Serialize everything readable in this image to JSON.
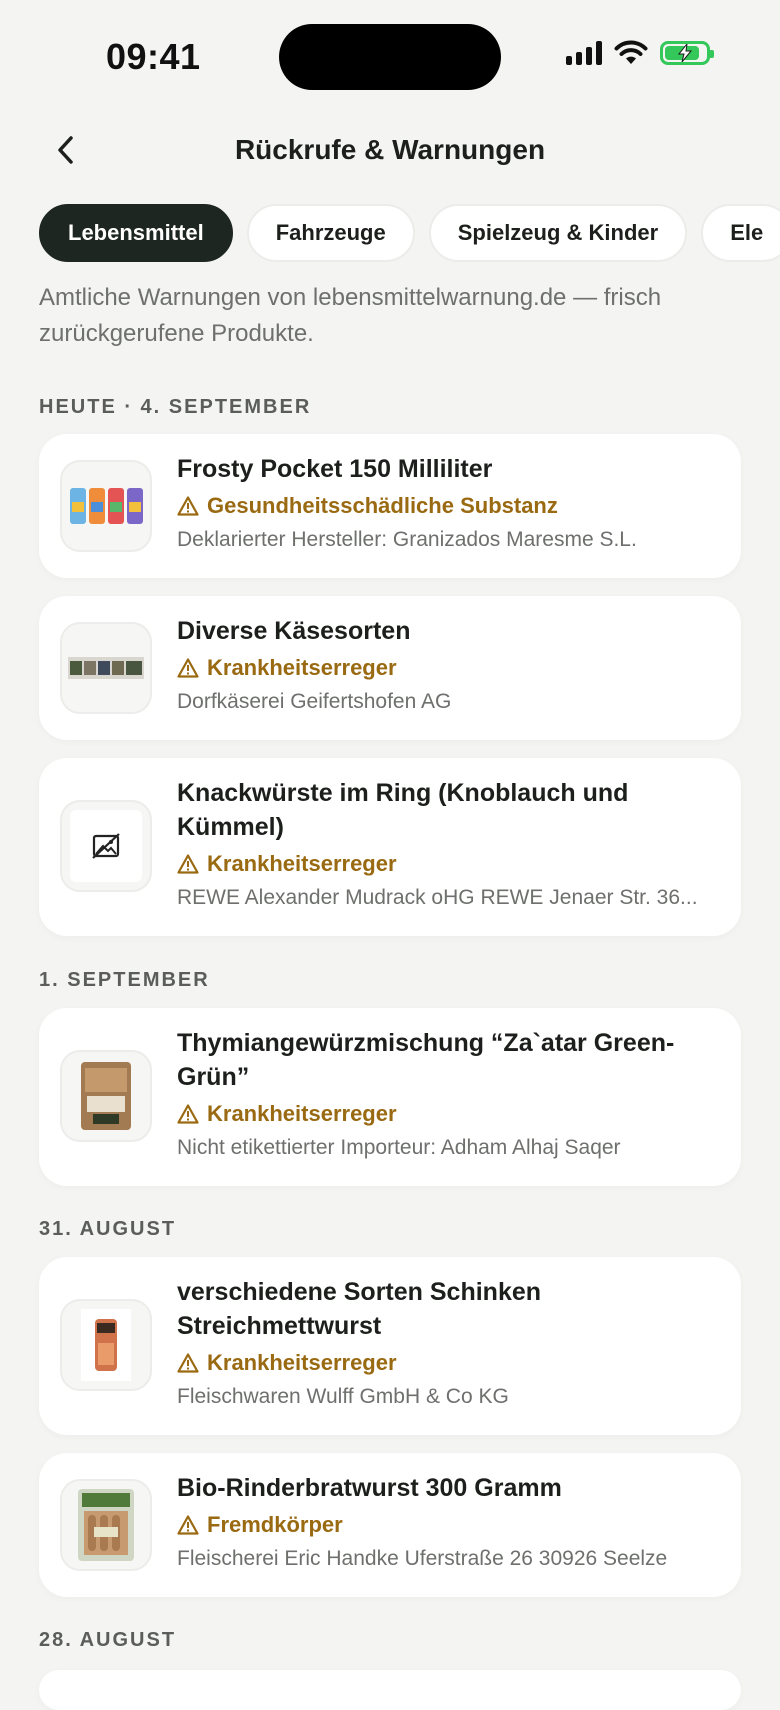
{
  "status_bar": {
    "time": "09:41"
  },
  "header": {
    "title": "Rückrufe & Warnungen"
  },
  "tabs": [
    {
      "label": "Lebensmittel",
      "active": true
    },
    {
      "label": "Fahrzeuge",
      "active": false
    },
    {
      "label": "Spielzeug & Kinder",
      "active": false
    },
    {
      "label": "Ele",
      "active": false
    }
  ],
  "intro": "Amtliche Warnungen von lebensmittelwarnung.de — frisch zurückgerufene Produkte.",
  "sections": [
    {
      "label": "HEUTE · 4. SEPTEMBER",
      "items": [
        {
          "title": "Frosty Pocket 150 Milliliter",
          "warning": "Gesundheitsschädliche Substanz",
          "subtitle": "Deklarierter Hersteller: Granizados Maresme S.L.",
          "thumb": "pouches"
        },
        {
          "title": "Diverse Käsesorten",
          "warning": "Krankheitserreger",
          "subtitle": "Dorfkäserei Geifertshofen AG",
          "thumb": "cheese-strip"
        },
        {
          "title": "Knackwürste im Ring (Knoblauch und Kümmel)",
          "warning": "Krankheitserreger",
          "subtitle": "REWE Alexander Mudrack oHG REWE Jenaer Str. 36...",
          "thumb": "image-missing-icon"
        }
      ]
    },
    {
      "label": "1. SEPTEMBER",
      "items": [
        {
          "title": "Thymiangewürzmischung “Za`atar Green-Grün”",
          "warning": "Krankheitserreger",
          "subtitle": "Nicht etikettierter Importeur: Adham Alhaj Saqer",
          "thumb": "spice-bag"
        }
      ]
    },
    {
      "label": "31. AUGUST",
      "items": [
        {
          "title": "verschiedene Sorten Schinken Streichmettwurst",
          "warning": "Krankheitserreger",
          "subtitle": "Fleischwaren Wulff GmbH & Co KG",
          "thumb": "sausage-pack"
        }
      ]
    },
    {
      "label": "28. AUGUST",
      "items": [
        {
          "title": "Bio-Rinderbratwurst 300 Gramm",
          "warning": "Fremdkörper",
          "subtitle": "Fleischerei Eric Handke Uferstraße 26 30926 Seelze",
          "thumb": "bratwurst-pack"
        }
      ]
    }
  ],
  "colors": {
    "accent_dark": "#1e2621",
    "warning": "#9a6a12",
    "background": "#f4f4f2"
  }
}
